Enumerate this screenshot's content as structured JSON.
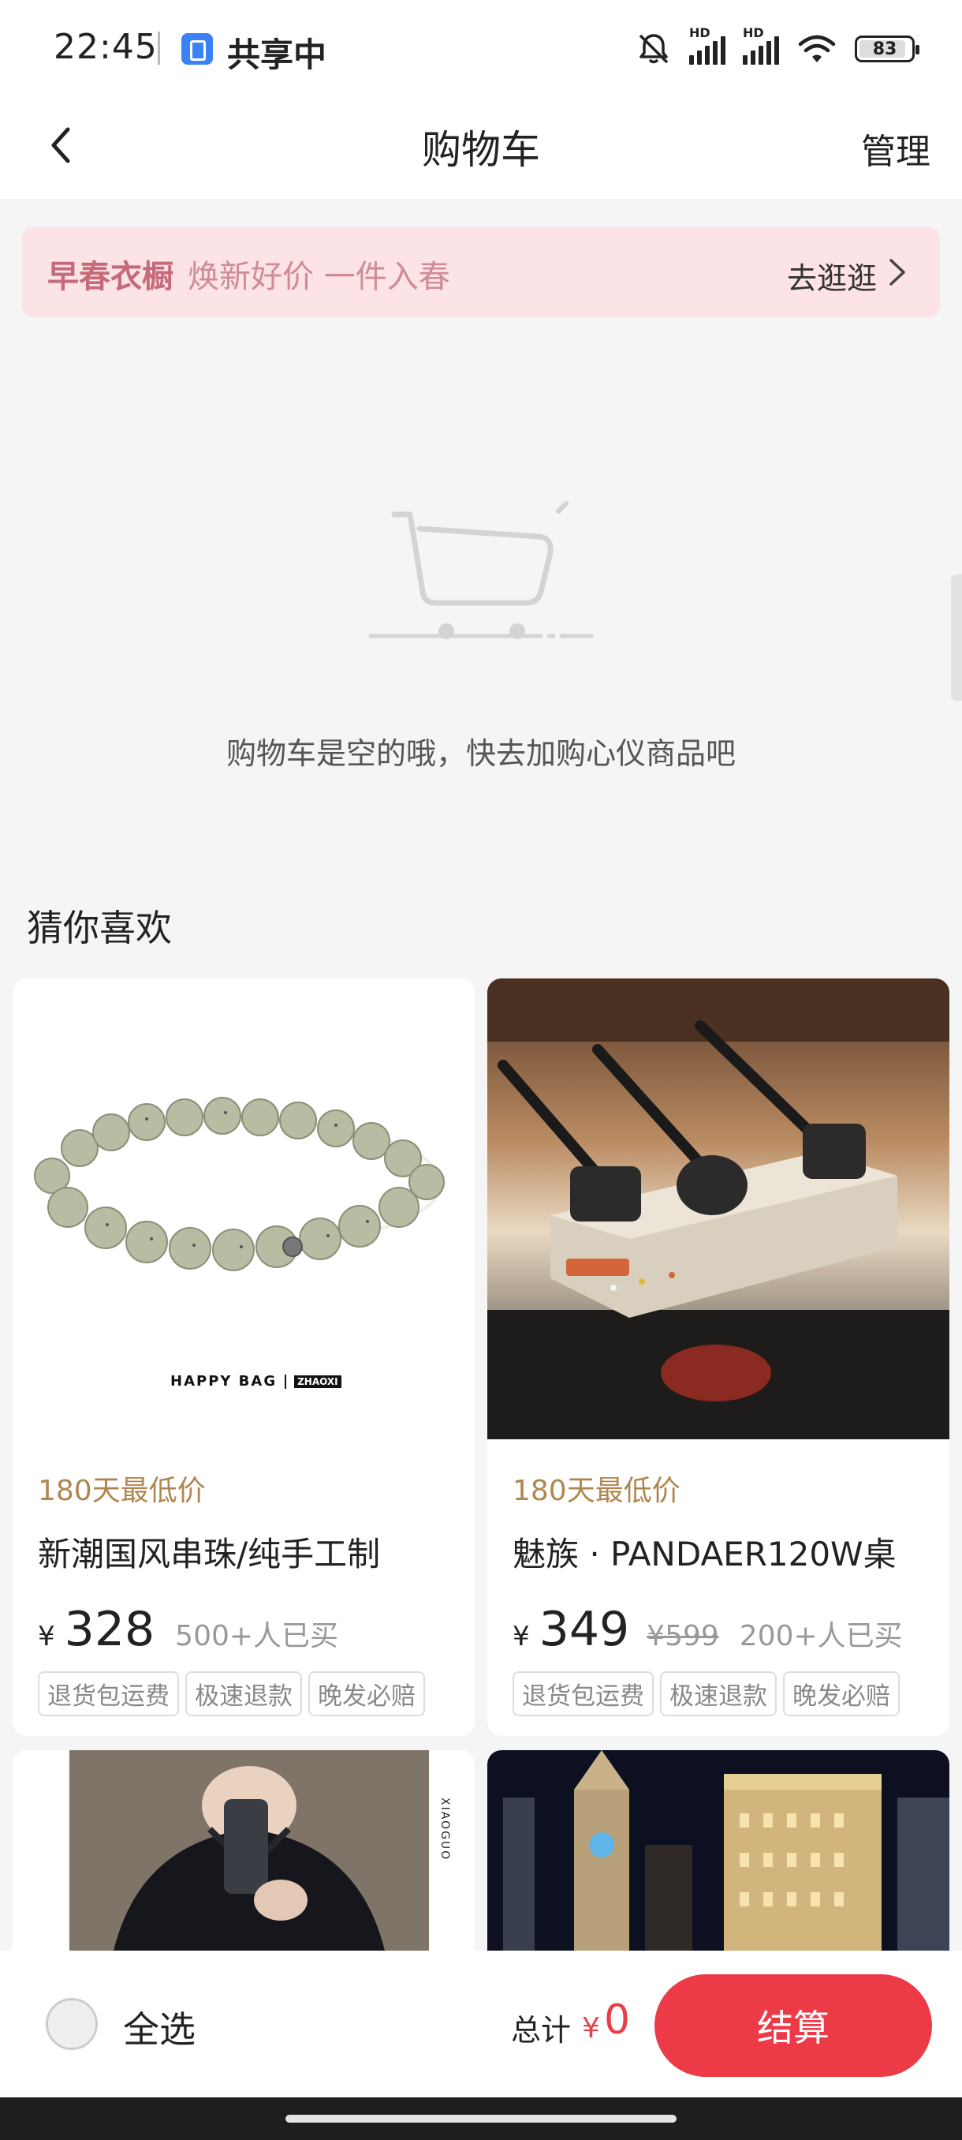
{
  "status_bar": {
    "time": "22:45",
    "sharing_label": "共享中",
    "hd1": "HD",
    "hd2": "HD",
    "battery": "83"
  },
  "nav": {
    "title": "购物车",
    "manage": "管理"
  },
  "promo": {
    "title": "早春衣橱",
    "subtitle": "焕新好价 一件入春",
    "action": "去逛逛"
  },
  "empty_cart": {
    "message": "购物车是空的哦，快去加购心仪商品吧"
  },
  "recommendations": {
    "title": "猜你喜欢",
    "items": [
      {
        "badge": "180天最低价",
        "name": "新潮国风串珠/纯手工制",
        "currency": "¥",
        "price": "328",
        "original_price": "",
        "sold": "500+人已买",
        "tags": [
          "退货包运费",
          "极速退款",
          "晚发必赔"
        ],
        "image_caption": "HAPPY BAG",
        "image_brand": "ZHAOXI"
      },
      {
        "badge": "180天最低价",
        "name": "魅族 · PANDAER120W桌",
        "currency": "¥",
        "price": "349",
        "original_price": "¥599",
        "sold": "200+人已买",
        "tags": [
          "退货包运费",
          "极速退款",
          "晚发必赔"
        ]
      },
      {
        "image_caption": "XIAOGUO"
      },
      {}
    ]
  },
  "bottom_bar": {
    "select_all": "全选",
    "total_label": "总计",
    "currency": "¥",
    "total": "0",
    "checkout": "结算"
  },
  "colors": {
    "accent_red": "#ec3b47",
    "price_red": "#e83e48",
    "badge_gold": "#b08650",
    "promo_bg": "#fbe3e6",
    "promo_title": "#c66a79"
  },
  "icons": [
    "share-screen-icon",
    "mute-icon",
    "signal-icon",
    "wifi-icon",
    "battery-icon",
    "back-icon",
    "chevron-right-icon",
    "empty-cart-icon",
    "radio-icon"
  ]
}
